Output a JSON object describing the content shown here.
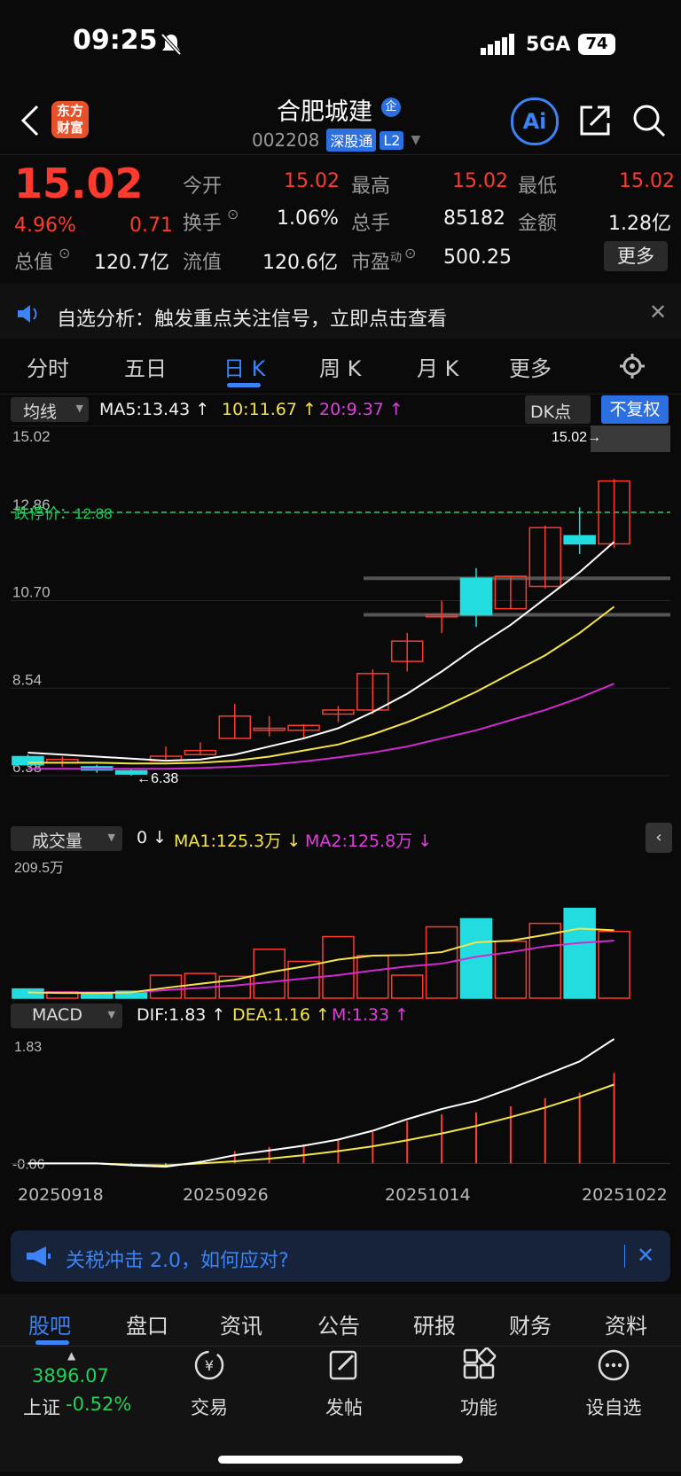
{
  "status_bar": {
    "time": "09:25",
    "network": "5GA",
    "battery": "74"
  },
  "header": {
    "logo_line1": "东方",
    "logo_line2": "财富",
    "stock_name": "合肥城建",
    "stock_code": "002208",
    "tag_connect": "深股通",
    "tag_level": "L2",
    "ai_label": "Ai"
  },
  "quote": {
    "price": "15.02",
    "change_pct": "4.96%",
    "change": "0.71",
    "open_label": "今开",
    "open": "15.02",
    "high_label": "最高",
    "high": "15.02",
    "low_label": "最低",
    "low": "15.02",
    "turnover_label": "换手",
    "turnover": "1.06%",
    "volume_label": "总手",
    "volume": "85182",
    "amount_label": "金额",
    "amount": "1.28亿",
    "mktcap_label": "总值",
    "mktcap": "120.7亿",
    "float_label": "流值",
    "float": "120.6亿",
    "pe_label": "市盈",
    "pe_sup": "动",
    "pe": "500.25",
    "more_label": "更多"
  },
  "notice": {
    "text": "自选分析：触发重点关注信号，立即点击查看"
  },
  "chart_tabs": [
    "分时",
    "五日",
    "日 K",
    "周 K",
    "月 K",
    "更多"
  ],
  "chart_toolbar": {
    "indicator": "均线",
    "ma5": "MA5:13.43",
    "ma10": "10:11.67",
    "ma20": "20:9.37",
    "dk_label": "DK点",
    "fq_label": "不复权"
  },
  "price_axis": [
    "15.02",
    "12.86",
    "10.70",
    "8.54",
    "6.38"
  ],
  "limit_down_label": "跌停价：12.88",
  "max_label": "15.02",
  "min_label": "6.38",
  "volume_panel": {
    "indicator": "成交量",
    "v0": "0",
    "ma1": "MA1:125.3万",
    "ma2": "MA2:125.8万",
    "max": "209.5万"
  },
  "macd_panel": {
    "indicator": "MACD",
    "dif": "DIF:1.83",
    "dea": "DEA:1.16",
    "m": "M:1.33",
    "top": "1.83",
    "bottom": "-0.06"
  },
  "date_axis": [
    "20250918",
    "20250926",
    "20251014",
    "20251022"
  ],
  "colors": {
    "up": "#ff3b30",
    "down": "#22dde0",
    "ma5": "#ffffff",
    "ma10": "#f5e54a",
    "ma20": "#d12ad0",
    "accent": "#3b83f6",
    "limit": "#22d15a",
    "bg": "#0a0a0a"
  },
  "chart_data": {
    "type": "candlestick",
    "candles": [
      {
        "o": 6.85,
        "c": 6.65,
        "h": 6.9,
        "l": 6.6,
        "vol": 16
      },
      {
        "o": 6.7,
        "c": 6.78,
        "h": 6.85,
        "l": 6.6,
        "vol": 11
      },
      {
        "o": 6.6,
        "c": 6.52,
        "h": 6.65,
        "l": 6.45,
        "vol": 8
      },
      {
        "o": 6.5,
        "c": 6.42,
        "h": 6.55,
        "l": 6.38,
        "vol": 12
      },
      {
        "o": 6.75,
        "c": 6.86,
        "h": 7.1,
        "l": 6.75,
        "vol": 40
      },
      {
        "o": 6.9,
        "c": 7.0,
        "h": 7.2,
        "l": 6.9,
        "vol": 43
      },
      {
        "o": 7.3,
        "c": 7.85,
        "h": 8.15,
        "l": 7.3,
        "vol": 38
      },
      {
        "o": 7.5,
        "c": 7.55,
        "h": 7.85,
        "l": 7.35,
        "vol": 85
      },
      {
        "o": 7.5,
        "c": 7.62,
        "h": 7.65,
        "l": 7.3,
        "vol": 64
      },
      {
        "o": 7.9,
        "c": 8.0,
        "h": 8.1,
        "l": 7.7,
        "vol": 107
      },
      {
        "o": 8.0,
        "c": 8.9,
        "h": 9.0,
        "l": 7.9,
        "vol": 74
      },
      {
        "o": 9.2,
        "c": 9.7,
        "h": 9.9,
        "l": 8.95,
        "vol": 40
      },
      {
        "o": 10.3,
        "c": 10.35,
        "h": 10.7,
        "l": 9.9,
        "vol": 124
      },
      {
        "o": 11.25,
        "c": 10.35,
        "h": 11.5,
        "l": 10.05,
        "vol": 138
      },
      {
        "o": 10.5,
        "c": 11.3,
        "h": 11.3,
        "l": 10.5,
        "vol": 99
      },
      {
        "o": 11.05,
        "c": 12.5,
        "h": 12.55,
        "l": 11.0,
        "vol": 130
      },
      {
        "o": 12.3,
        "c": 12.1,
        "h": 13.0,
        "l": 11.85,
        "vol": 156
      },
      {
        "o": 12.1,
        "c": 13.65,
        "h": 13.7,
        "l": 12.0,
        "vol": 116
      }
    ],
    "ma5": [
      6.95,
      6.9,
      6.85,
      6.8,
      6.75,
      6.78,
      6.9,
      7.1,
      7.3,
      7.55,
      7.95,
      8.4,
      8.95,
      9.55,
      10.1,
      10.75,
      11.4,
      12.15
    ],
    "ma10": [
      6.7,
      6.7,
      6.7,
      6.68,
      6.68,
      6.7,
      6.75,
      6.85,
      7.0,
      7.15,
      7.4,
      7.7,
      8.05,
      8.45,
      8.9,
      9.35,
      9.9,
      10.55
    ],
    "ma20": [
      6.55,
      6.55,
      6.55,
      6.55,
      6.55,
      6.57,
      6.6,
      6.65,
      6.73,
      6.83,
      6.95,
      7.1,
      7.3,
      7.5,
      7.75,
      8.0,
      8.3,
      8.65
    ],
    "vol_ma1": [
      10,
      9,
      9,
      10,
      18,
      25,
      32,
      45,
      55,
      67,
      74,
      75,
      80,
      97,
      100,
      110,
      121,
      118
    ],
    "vol_ma2": [
      10,
      10,
      10,
      10,
      14,
      18,
      22,
      28,
      34,
      40,
      48,
      55,
      60,
      72,
      80,
      90,
      96,
      100
    ],
    "dif": [
      0,
      0,
      0,
      -0.03,
      -0.05,
      0.02,
      0.12,
      0.19,
      0.26,
      0.35,
      0.48,
      0.65,
      0.8,
      0.92,
      1.1,
      1.3,
      1.5,
      1.83
    ],
    "dea": [
      0,
      0,
      0,
      -0.02,
      -0.03,
      0.0,
      0.03,
      0.07,
      0.12,
      0.18,
      0.25,
      0.34,
      0.44,
      0.55,
      0.68,
      0.82,
      0.98,
      1.16
    ],
    "macd": [
      0,
      0,
      0,
      -0.02,
      -0.04,
      0.04,
      0.18,
      0.24,
      0.28,
      0.34,
      0.46,
      0.62,
      0.72,
      0.75,
      0.84,
      0.96,
      1.04,
      1.33
    ],
    "ylim": [
      6.38,
      15.02
    ]
  },
  "promo": {
    "text": "关税冲击 2.0，如何应对?"
  },
  "bottom_tabs": [
    "股吧",
    "盘口",
    "资讯",
    "公告",
    "研报",
    "财务",
    "资料"
  ],
  "index": {
    "value": "3896.07",
    "name": "上证",
    "change": "-0.52%"
  },
  "dock": [
    "交易",
    "发帖",
    "功能",
    "设自选"
  ]
}
